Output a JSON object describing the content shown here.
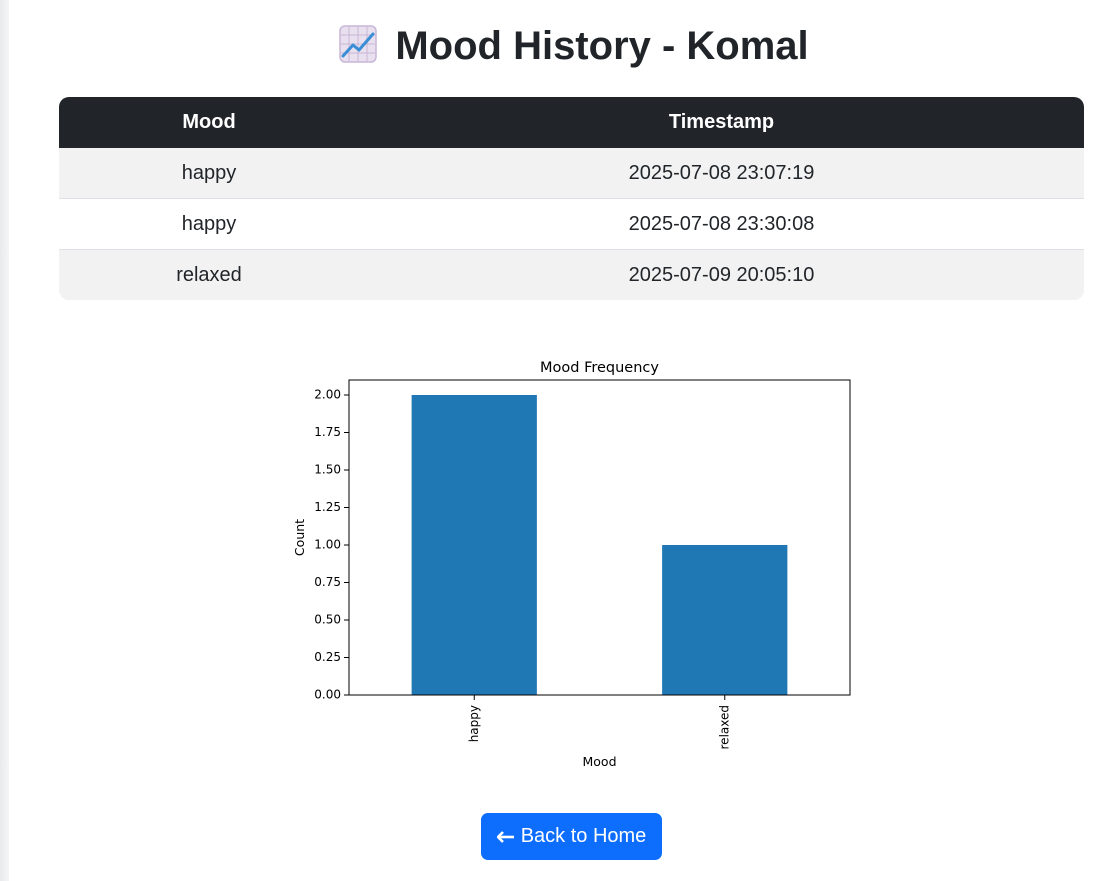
{
  "page": {
    "title_icon": "chart-increasing-icon",
    "title": "Mood History - Komal"
  },
  "table": {
    "headers": {
      "mood": "Mood",
      "timestamp": "Timestamp"
    },
    "rows": [
      {
        "mood": "happy",
        "timestamp": "2025-07-08 23:07:19"
      },
      {
        "mood": "happy",
        "timestamp": "2025-07-08 23:30:08"
      },
      {
        "mood": "relaxed",
        "timestamp": "2025-07-09 20:05:10"
      }
    ]
  },
  "chart_data": {
    "type": "bar",
    "title": "Mood Frequency",
    "xlabel": "Mood",
    "ylabel": "Count",
    "categories": [
      "happy",
      "relaxed"
    ],
    "values": [
      2,
      1
    ],
    "ylim": [
      0,
      2.1
    ],
    "yticks": [
      "0.00",
      "0.25",
      "0.50",
      "0.75",
      "1.00",
      "1.25",
      "1.50",
      "1.75",
      "2.00"
    ],
    "bar_color": "#1f77b4",
    "grid": false,
    "legend": "none"
  },
  "back_button": {
    "arrow_icon": "left-arrow-icon",
    "label": "Back to Home"
  },
  "colors": {
    "header_bg": "#212529",
    "button_bg": "#0d6efd"
  }
}
